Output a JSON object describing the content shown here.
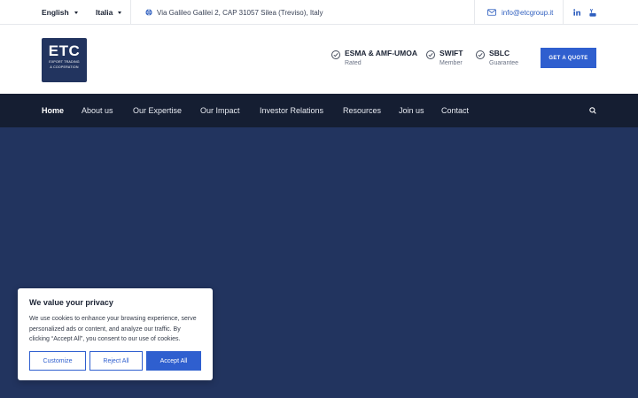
{
  "topbar": {
    "language": "English",
    "country": "Italia",
    "address": "Via Galileo Galilei 2, CAP 31057 Silea (Treviso), Italy",
    "email": "info@etcgroup.it",
    "social": [
      "linkedin-icon",
      "youtube-icon"
    ]
  },
  "header": {
    "logo": {
      "main": "ETC",
      "line1": "EXPORT TRADING",
      "line2": "& COOPERATION"
    },
    "badges": [
      {
        "title": "ESMA & AMF-UMOA",
        "sub": "Rated"
      },
      {
        "title": "SWIFT",
        "sub": "Member"
      },
      {
        "title": "SBLC",
        "sub": "Guarantee"
      }
    ],
    "quote_label": "GET A QUOTE"
  },
  "nav": {
    "items": [
      "Home",
      "About us",
      "Our Expertise",
      "Our Impact",
      "Investor Relations",
      "Resources",
      "Join us",
      "Contact"
    ],
    "active": "Home"
  },
  "colors": {
    "accent": "#2f5fcf",
    "nav_bg": "#151e32",
    "hero_bg": "#22345f"
  },
  "cookie": {
    "title": "We value your privacy",
    "text": "We use cookies to enhance your browsing experience, serve personalized ads or content, and analyze our traffic. By clicking “Accept All”, you consent to our use of cookies.",
    "customize": "Customize",
    "reject": "Reject All",
    "accept": "Accept All"
  }
}
